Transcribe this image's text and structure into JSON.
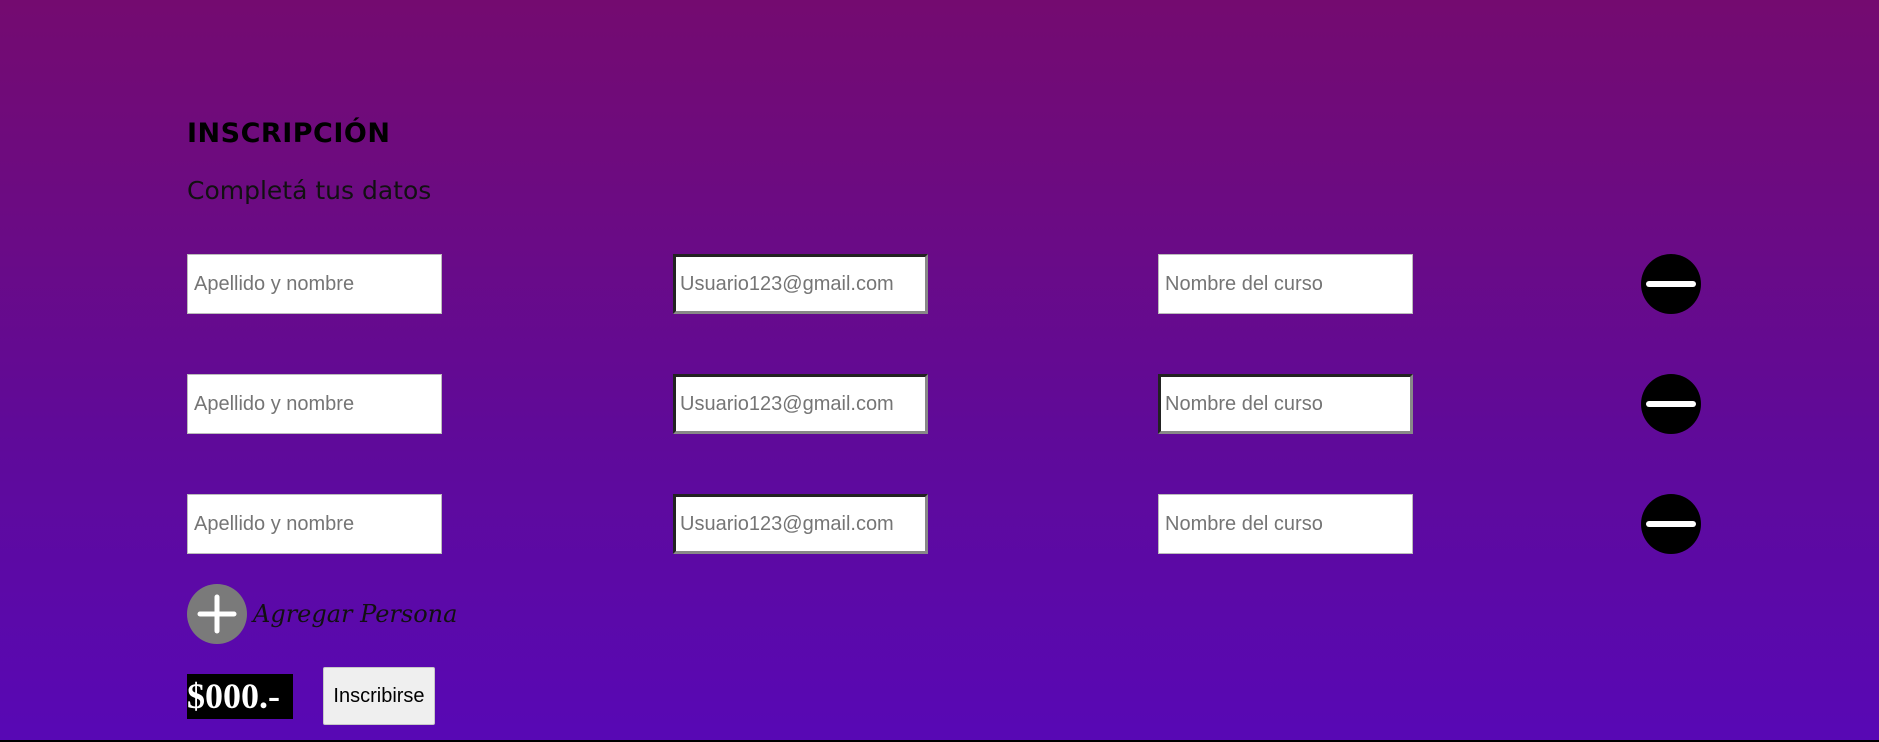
{
  "form": {
    "title": "INSCRIPCIÓN",
    "subtitle": "Completá tus datos",
    "rows": [
      {
        "name_placeholder": "Apellido y nombre",
        "email_placeholder": "Usuario123@gmail.com",
        "course_placeholder": "Nombre del curso",
        "remove_icon": "minus-circle-icon"
      },
      {
        "name_placeholder": "Apellido y nombre",
        "email_placeholder": "Usuario123@gmail.com",
        "course_placeholder": "Nombre del curso",
        "remove_icon": "minus-circle-icon"
      },
      {
        "name_placeholder": "Apellido y nombre",
        "email_placeholder": "Usuario123@gmail.com",
        "course_placeholder": "Nombre del curso",
        "remove_icon": "minus-circle-icon"
      }
    ],
    "add_person": {
      "label": "Agregar Persona",
      "icon": "plus-circle-icon"
    },
    "price": "$000.-",
    "submit_label": "Inscribirse"
  },
  "colors": {
    "background_top": "#740b70",
    "background_bottom": "#5808b5",
    "remove_button": "#000000",
    "add_button": "#7a7a7a",
    "price_background": "#000000",
    "price_text": "#ffffff"
  }
}
